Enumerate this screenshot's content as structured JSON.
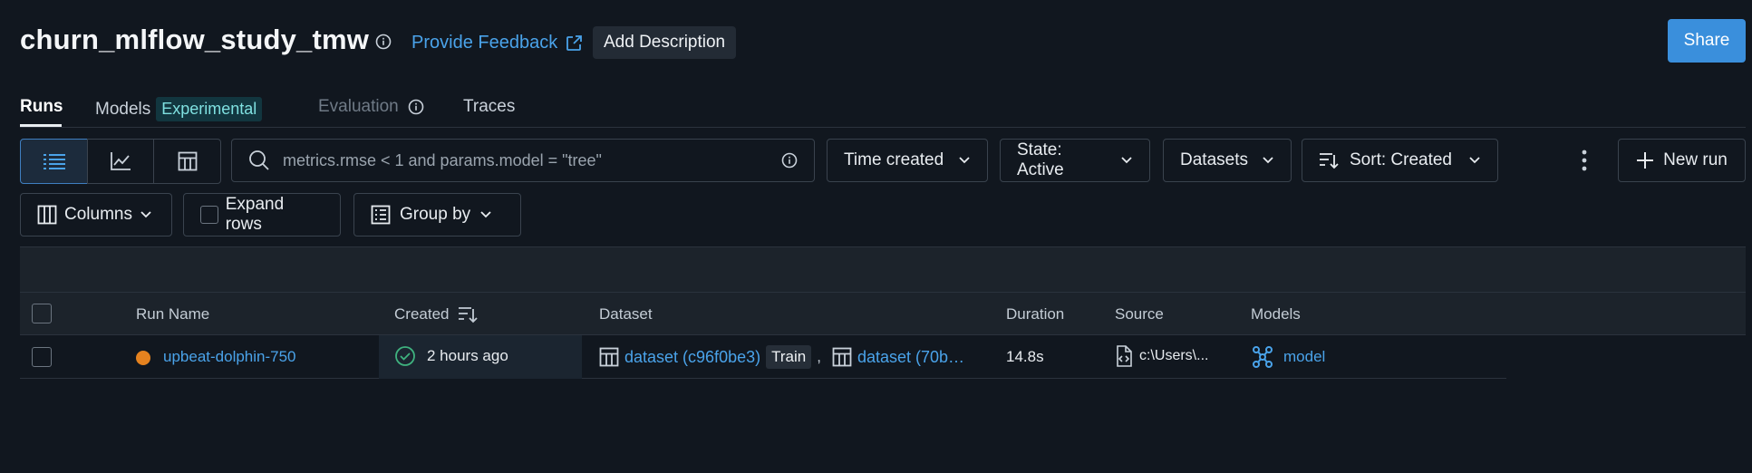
{
  "header": {
    "title": "churn_mlflow_study_tmw",
    "feedback_label": "Provide Feedback",
    "add_description_label": "Add Description",
    "share_label": "Share"
  },
  "tabs": [
    {
      "label": "Runs",
      "active": true
    },
    {
      "label": "Models",
      "badge": "Experimental"
    },
    {
      "label": "Evaluation",
      "disabled": true
    },
    {
      "label": "Traces"
    }
  ],
  "toolbar": {
    "search_placeholder": "metrics.rmse < 1 and params.model = \"tree\"",
    "time_created_label": "Time created",
    "state_label": "State: Active",
    "datasets_label": "Datasets",
    "sort_label": "Sort: Created",
    "new_run_label": "New run",
    "columns_label": "Columns",
    "expand_rows_label": "Expand rows",
    "group_by_label": "Group by"
  },
  "table": {
    "headers": [
      "Run Name",
      "Created",
      "Dataset",
      "Duration",
      "Source",
      "Models"
    ],
    "rows": [
      {
        "run_name": "upbeat-dolphin-750",
        "status_color": "#e5821f",
        "created": "2 hours ago",
        "dataset1": "dataset (c96f0be3)",
        "dataset1_tag": "Train",
        "separator": ",",
        "dataset2": "dataset (70b…",
        "duration": "14.8s",
        "source": "c:\\Users\\...",
        "model": "model"
      }
    ]
  },
  "colors": {
    "background": "#11171f",
    "accent": "#3a8fdc",
    "link": "#4aa3ea",
    "success": "#3fb27f"
  }
}
